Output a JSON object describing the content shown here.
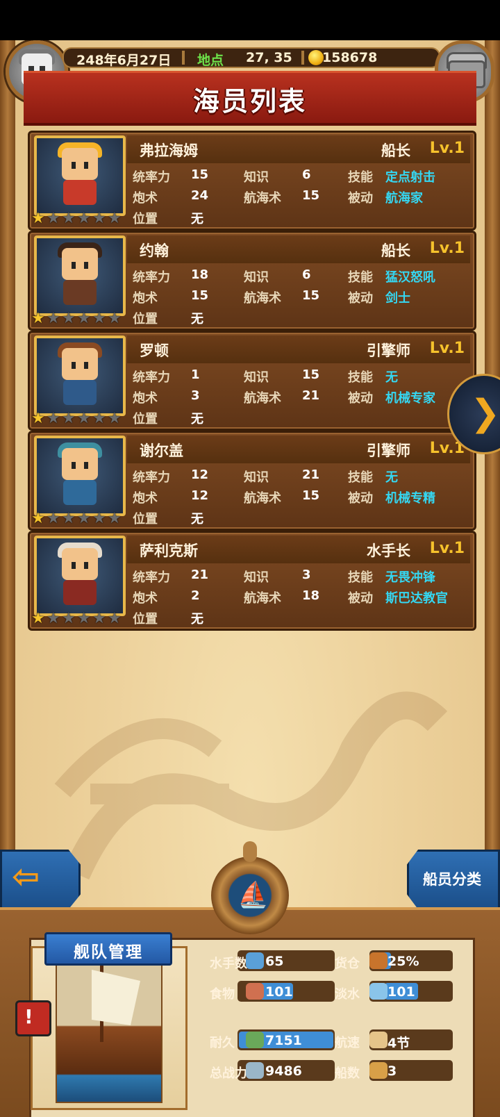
{
  "header": {
    "date": "248年6月27日",
    "location_label": "地点",
    "location_value": "27, 35",
    "gold": "158678",
    "title": "海员列表"
  },
  "crew": [
    {
      "name": "弗拉海姆",
      "role": "船长",
      "level": "Lv.1",
      "stars": 1,
      "stats": {
        "command_label": "统率力",
        "command": "15",
        "knowledge_label": "知识",
        "knowledge": "6",
        "gunnery_label": "炮术",
        "gunnery": "24",
        "navigation_label": "航海术",
        "navigation": "15",
        "position_label": "位置",
        "position": "无"
      },
      "skill_label": "技能",
      "skill": "定点射击",
      "passive_label": "被动",
      "passive": "航海家",
      "colors": {
        "hair": "#f5b428",
        "body": "#c83a2a"
      }
    },
    {
      "name": "约翰",
      "role": "船长",
      "level": "Lv.1",
      "stars": 1,
      "stats": {
        "command_label": "统率力",
        "command": "18",
        "knowledge_label": "知识",
        "knowledge": "6",
        "gunnery_label": "炮术",
        "gunnery": "15",
        "navigation_label": "航海术",
        "navigation": "15",
        "position_label": "位置",
        "position": "无"
      },
      "skill_label": "技能",
      "skill": "猛汉怒吼",
      "passive_label": "被动",
      "passive": "剑士",
      "colors": {
        "hair": "#3a2418",
        "body": "#6a3a24"
      }
    },
    {
      "name": "罗顿",
      "role": "引擎师",
      "level": "Lv.1",
      "stars": 1,
      "stats": {
        "command_label": "统率力",
        "command": "1",
        "knowledge_label": "知识",
        "knowledge": "15",
        "gunnery_label": "炮术",
        "gunnery": "3",
        "navigation_label": "航海术",
        "navigation": "21",
        "position_label": "位置",
        "position": "无"
      },
      "skill_label": "技能",
      "skill": "无",
      "passive_label": "被动",
      "passive": "机械专家",
      "colors": {
        "hair": "#8a4a22",
        "body": "#2f5a8a"
      }
    },
    {
      "name": "谢尔盖",
      "role": "引擎师",
      "level": "Lv.1",
      "stars": 1,
      "stats": {
        "command_label": "统率力",
        "command": "12",
        "knowledge_label": "知识",
        "knowledge": "21",
        "gunnery_label": "炮术",
        "gunnery": "12",
        "navigation_label": "航海术",
        "navigation": "15",
        "position_label": "位置",
        "position": "无"
      },
      "skill_label": "技能",
      "skill": "无",
      "passive_label": "被动",
      "passive": "机械专精",
      "colors": {
        "hair": "#3e8fa0",
        "body": "#2f6a9a"
      }
    },
    {
      "name": "萨利克斯",
      "role": "水手长",
      "level": "Lv.1",
      "stars": 1,
      "stats": {
        "command_label": "统率力",
        "command": "21",
        "knowledge_label": "知识",
        "knowledge": "3",
        "gunnery_label": "炮术",
        "gunnery": "2",
        "navigation_label": "航海术",
        "navigation": "18",
        "position_label": "位置",
        "position": "无"
      },
      "skill_label": "技能",
      "skill": "无畏冲锋",
      "passive_label": "被动",
      "passive": "斯巴达教官",
      "colors": {
        "hair": "#e6dccd",
        "body": "#8a2a22"
      }
    }
  ],
  "nav": {
    "back_icon": "arrow-left-icon",
    "next_icon": "chevron-right-icon",
    "classify_label": "船员分类",
    "wheel_icon": "ship-wheel-icon"
  },
  "fleet": {
    "title": "舰队管理",
    "sailors_label": "水手数",
    "sailors": "65",
    "cargo_label": "货仓",
    "cargo": "25%",
    "cargo_fill": 0.25,
    "food_label": "食物",
    "food": "101",
    "water_label": "淡水",
    "water": "101",
    "durability_label": "耐久",
    "durability": "7151",
    "durability_fill": 1.0,
    "speed_label": "航速",
    "speed": "4节",
    "power_label": "总战力",
    "power": "9486",
    "ships_label": "船数",
    "ships": "3",
    "alert_mark": "!"
  }
}
